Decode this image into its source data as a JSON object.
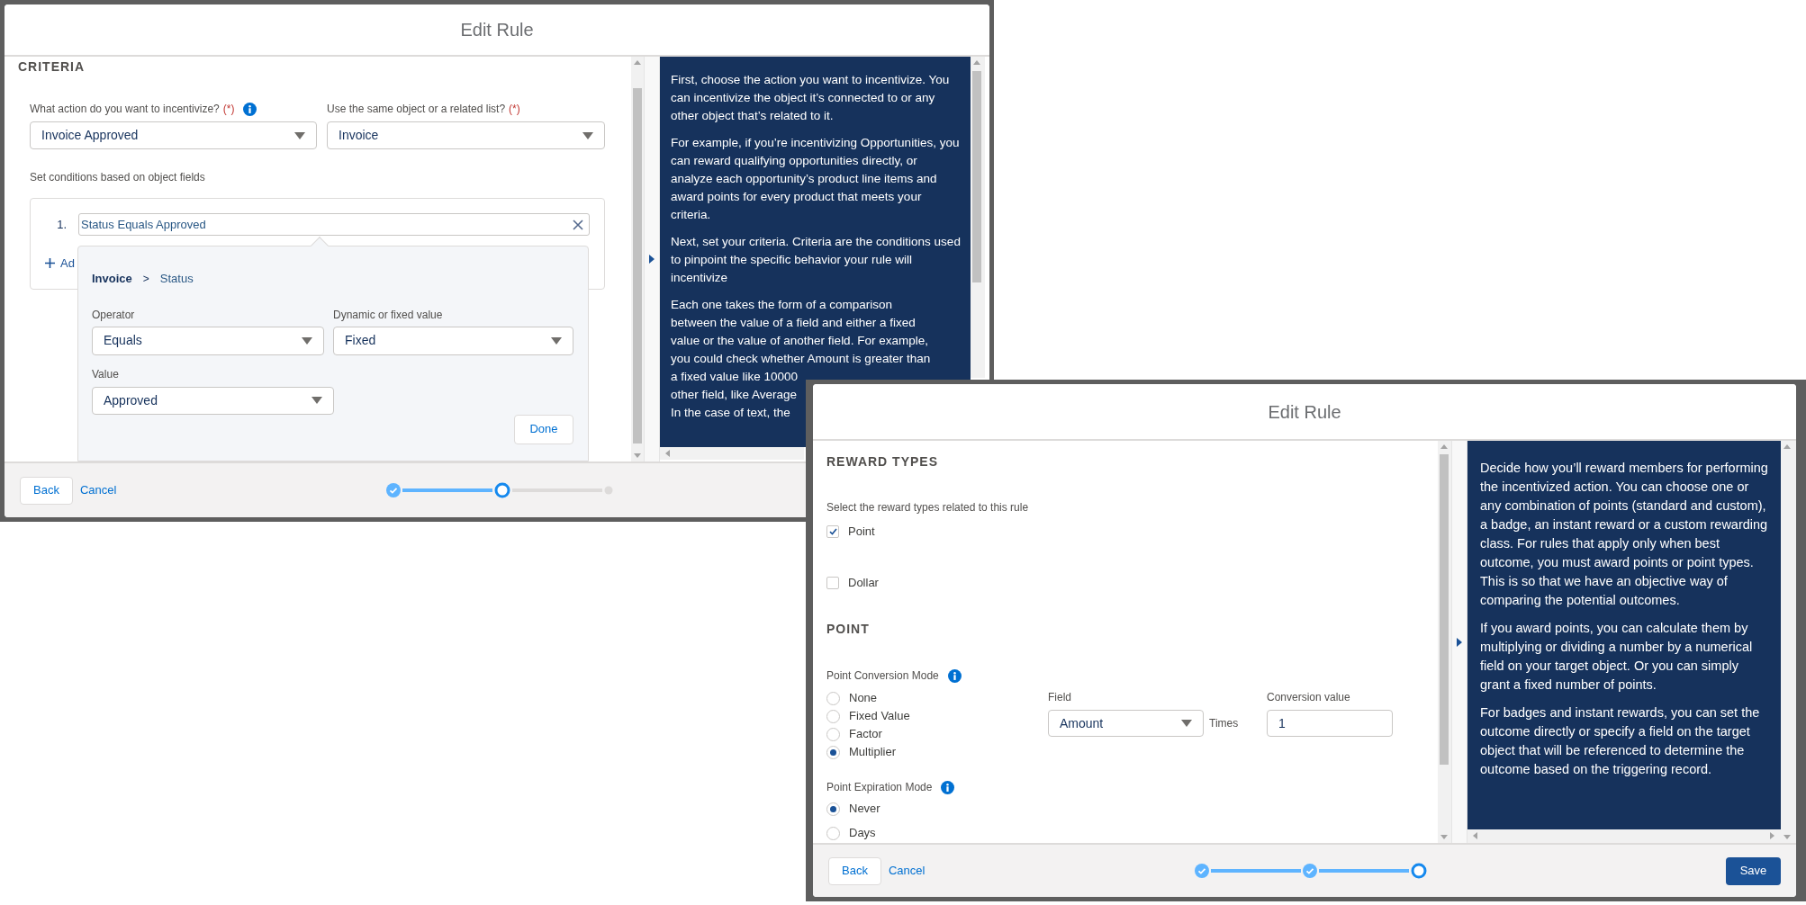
{
  "criteria_dialog": {
    "title": "Edit Rule",
    "section_heading": "CRITERIA",
    "fields": [
      {
        "label": "What action do you want to incentivize?",
        "required": "(*)",
        "info": true,
        "value": "Invoice Approved"
      },
      {
        "label": "Use the same object or a related list?",
        "required": "(*)",
        "info": false,
        "value": "Invoice"
      }
    ],
    "conditions_label": "Set conditions based on object fields",
    "conditions": [
      {
        "number": "1.",
        "text": "Status Equals Approved"
      }
    ],
    "add_link": "Ad",
    "popover": {
      "breadcrumb": [
        "Invoice",
        ">",
        "Status"
      ],
      "operator": {
        "label": "Operator",
        "value": "Equals"
      },
      "mode": {
        "label": "Dynamic or fixed value",
        "value": "Fixed"
      },
      "value": {
        "label": "Value",
        "value": "Approved"
      },
      "done": "Done"
    },
    "help": [
      {
        "kind": "wrapped",
        "text": "First, choose the action you want to incentivize. You can incentivize the object it’s connected to or any other object that’s related to it."
      },
      {
        "kind": "wrapped",
        "text": "For example, if you’re incentivizing Opportunities, you can reward qualifying opportunities directly, or analyze each opportunity’s product line items and award points for every product that meets your criteria."
      },
      {
        "kind": "wrapped",
        "text": "Next, set your criteria. Criteria are the conditions used to pinpoint the specific behavior your rule will incentivize"
      },
      {
        "kind": "lines",
        "lines": [
          "Each one takes the form of a comparison",
          "between the value of a field and either a fixed",
          "value or the value of another field. For example,",
          "you could check whether Amount is greater than",
          "a fixed value like 10000",
          "other field, like Average",
          "In the case of text, the"
        ]
      }
    ],
    "footer": {
      "back": "Back",
      "cancel": "Cancel"
    },
    "steps": [
      {
        "kind": "complete"
      },
      {
        "kind": "current"
      },
      {
        "kind": "upcoming"
      }
    ]
  },
  "reward_dialog": {
    "title": "Edit Rule",
    "section_heading": "REWARD TYPES",
    "prompt": "Select the reward types related to this rule",
    "reward_types": [
      {
        "label": "Point",
        "checked": true
      },
      {
        "label": "Dollar",
        "checked": false
      }
    ],
    "point_heading": "POINT",
    "conversion_mode": {
      "label": "Point Conversion Mode",
      "info": true,
      "options": [
        {
          "label": "None",
          "selected": false
        },
        {
          "label": "Fixed Value",
          "selected": false
        },
        {
          "label": "Factor",
          "selected": false
        },
        {
          "label": "Multiplier",
          "selected": true
        }
      ]
    },
    "field": {
      "label": "Field",
      "value": "Amount"
    },
    "times": "Times",
    "conversion_value": {
      "label": "Conversion value",
      "value": "1"
    },
    "expiration_mode": {
      "label": "Point Expiration Mode",
      "info": true,
      "options": [
        {
          "label": "Never",
          "selected": true
        },
        {
          "label": "Days",
          "selected": false
        }
      ]
    },
    "help": [
      {
        "kind": "wrapped",
        "text": "Decide how you’ll reward members for performing the incentivized action. You can choose one or any combination of points (standard and custom), a badge, an instant reward or a custom rewarding class. For rules that apply only when best outcome, you must award points or point types. This is so that we have an objective way of comparing the potential outcomes."
      },
      {
        "kind": "wrapped",
        "text": "If you award points, you can calculate them by multiplying or dividing a number by a numerical field on your target object. Or you can simply grant a fixed number of points."
      },
      {
        "kind": "wrapped",
        "text": "For badges and instant rewards, you can set the outcome directly or specify a field on the target object that will be referenced to determine the outcome based on the triggering record."
      }
    ],
    "footer": {
      "back": "Back",
      "cancel": "Cancel",
      "save": "Save"
    },
    "steps": [
      {
        "kind": "complete"
      },
      {
        "kind": "complete"
      },
      {
        "kind": "current"
      }
    ]
  }
}
